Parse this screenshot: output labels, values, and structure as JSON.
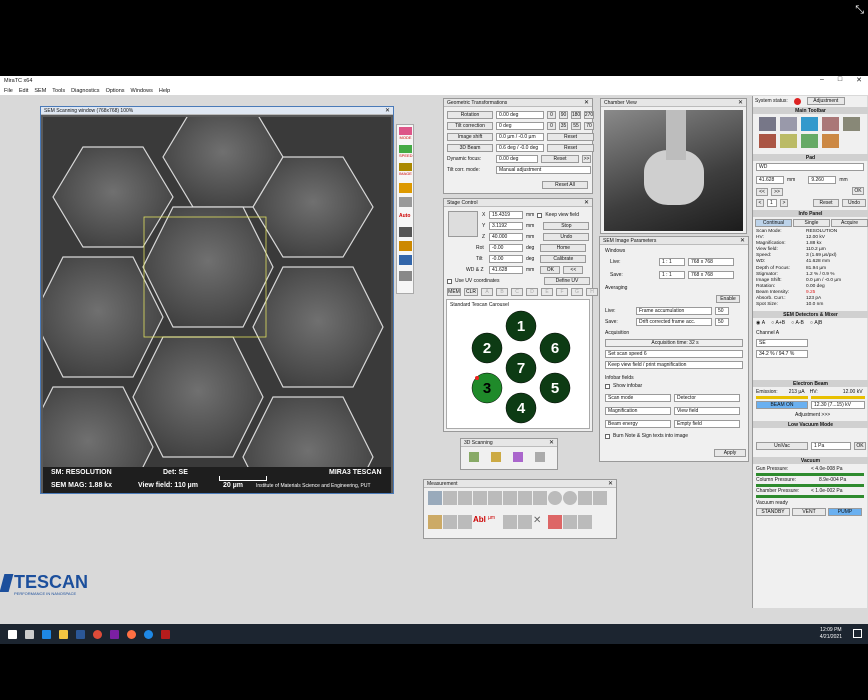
{
  "app": {
    "title": "MiraTC x64",
    "menus": [
      "File",
      "Edit",
      "SEM",
      "Tools",
      "Diagnostics",
      "Options",
      "Windows",
      "Help"
    ]
  },
  "scan": {
    "title": "SEM Scanning window (768x768) 100%",
    "sm": "SM: RESOLUTION",
    "det": "Det: SE",
    "brand": "MIRA3 TESCAN",
    "mag": "SEM MAG: 1.88 kx",
    "view": "View field: 110 µm",
    "scale": "20 µm",
    "inst": "Institute of Materials Science and Engineering, PUT"
  },
  "side_tools": [
    "MODE",
    "SPEED",
    "IMAGE",
    "Auto"
  ],
  "geo": {
    "title": "Geometric Transformations",
    "rotation_lbl": "Rotation",
    "rotation_val": "0.00 deg",
    "rot_presets": [
      "0",
      "90",
      "180",
      "270"
    ],
    "tilt_lbl": "Tilt correction",
    "tilt_val": "0 deg",
    "tilt_presets": [
      "0",
      "35",
      "55",
      "70"
    ],
    "shift_lbl": "Image shift",
    "shift_val": "0.0 µm / -0.0 µm",
    "reset": "Reset",
    "beam_lbl": "3D Beam",
    "beam_val": "0.6 deg / -0.0 deg",
    "dyn_lbl": "Dynamic focus:",
    "dyn_val": "0.00 deg",
    "mode_lbl": "Tilt corr. mode:",
    "mode_val": "Manual adjustment",
    "reset_all": "Reset All"
  },
  "stage": {
    "title": "Stage Control",
    "x": "15.4319",
    "y": "3.1192",
    "z": "40.000",
    "rot": "-0.00",
    "tilt": "-0.00",
    "wd": "41.628",
    "unit_mm": "mm",
    "unit_deg": "deg",
    "keep": "Keep view field",
    "stop": "Stop",
    "undo": "Undo",
    "home": "Home",
    "calibrate": "Calibrate",
    "ok": "OK",
    "define": "Define UV",
    "uv": "Use UV coordinates",
    "mem": "MEM",
    "clr": "CLR",
    "slots": [
      "A",
      "B",
      "C",
      "D",
      "E",
      "F",
      "G",
      "H"
    ],
    "carousel": "Standard Tescan Carousel",
    "positions": [
      "1",
      "2",
      "3",
      "4",
      "5",
      "6",
      "7"
    ],
    "labels": {
      "x": "X",
      "y": "Y",
      "z": "Z",
      "rot": "Rot",
      "tilt": "Tilt",
      "wdz": "WD & Z"
    }
  },
  "chamber": {
    "title": "Chamber View"
  },
  "imgparam": {
    "title": "SEM Image Parameters",
    "windows": "Windows",
    "live": "Live:",
    "save": "Save:",
    "live_ratio": "1 : 1",
    "save_ratio": "1 : 1",
    "live_res": "768 x 768",
    "save_res": "768 x 768",
    "averaging": "Averaging",
    "enable": "Enable",
    "live_acc": "Frame accumulation",
    "save_acc": "Drift corrected frame acc.",
    "live_n": "50",
    "save_n": "50",
    "acquisition": "Acquisition",
    "acq_time": "Acquisition time: 32 s",
    "speed": "Set scan speed 6",
    "keep": "Keep view field / print magnification",
    "infobar": "Infobar fields",
    "show": "Show infobar",
    "f1": "Scan mode",
    "f2": "Detector",
    "f3": "Magnification",
    "f4": "View field",
    "f5": "Beam energy",
    "f6": "Empty field",
    "burn": "Burn Note & Sign texts into image",
    "apply": "Apply"
  },
  "d3": {
    "title": "3D Scanning"
  },
  "meas": {
    "title": "Measurement"
  },
  "right": {
    "status": "System status:",
    "adjustment": "Adjustment",
    "main_toolbar": "Main Toolbar",
    "pad": "Pad",
    "pad_sel": "WD",
    "pad_v1": "41.628",
    "pad_v2": "9.260",
    "mm": "mm",
    "pad_step": "1",
    "reset": "Reset",
    "undo": "Undo",
    "ok": "OK",
    "info": "Info Panel",
    "tabs": [
      "Continual",
      "Single",
      "Acquire"
    ],
    "info_rows": [
      [
        "Scan Mode:",
        "RESOLUTION"
      ],
      [
        "HV:",
        "12.00 kV"
      ],
      [
        "Magnification:",
        "1.88 kx"
      ],
      [
        "View field:",
        "110.2 µm"
      ],
      [
        "Speed:",
        "3 (1.69 µs/pxl)"
      ],
      [
        "WD:",
        "41.628 mm"
      ],
      [
        "Depth of Focus:",
        "81.94 µm"
      ],
      [
        "Stigmator:",
        "1.2 % / 0.9 %"
      ],
      [
        "Image Shift:",
        "0.0 µm / -0.0 µm"
      ],
      [
        "Rotation:",
        "0.00 deg"
      ],
      [
        "Beam Intensity:",
        "9.25"
      ],
      [
        "Absorb. Curr.:",
        "123 pA"
      ],
      [
        "Spot Size:",
        "10.0 nm"
      ]
    ],
    "det_title": "SEM Detectors & Mixer",
    "det_opts": [
      "A",
      "A+B",
      "A-B",
      "A|B"
    ],
    "channel": "Channel A",
    "ch_val": "SE",
    "contrast": "34.2 % / 94.7 %",
    "beam_title": "Electron Beam",
    "emission": "Emission:",
    "emission_val": "213 µA",
    "hv": "HV:",
    "hv_val": "12.00 kV",
    "beam_on": "BEAM ON",
    "hv_set": "12.30 (7...15) kV",
    "adj": "Adjustment >>>",
    "lv_title": "Low Vacuum Mode",
    "uni": "UniVac",
    "pa": "1 Pa",
    "vac_title": "Vacuum",
    "gun": "Gun Pressure:",
    "gun_v": "< 4.0e-008 Pa",
    "col": "Column Pressure:",
    "col_v": "8.9e-004 Pa",
    "ch": "Chamber Pressure:",
    "ch_v": "< 1.0e-002 Pa",
    "ready": "Vacuum ready",
    "standby": "STANDBY",
    "vent": "VENT",
    "pump": "PUMP"
  },
  "logo": {
    "name": "TESCAN",
    "tag": "PERFORMANCE IN NANOSPACE"
  },
  "clock": {
    "time": "12:09 PM",
    "date": "4/21/2021"
  }
}
